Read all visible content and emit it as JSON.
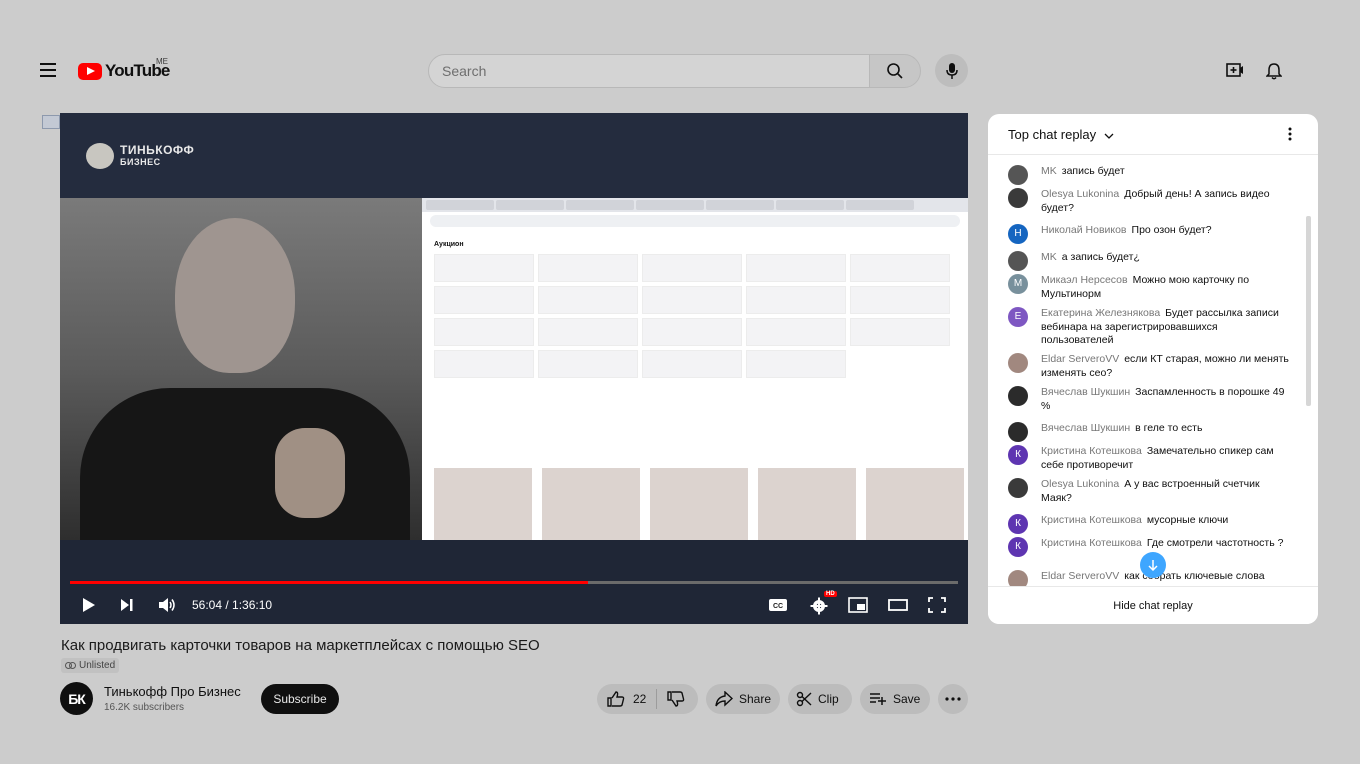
{
  "header": {
    "logo_text": "YouTube",
    "country": "ME",
    "search_placeholder": "Search"
  },
  "video": {
    "brand_line1": "ТИНЬКОФФ",
    "brand_line2": "БИЗНЕС",
    "screen_heading": "Аукцион",
    "time_current": "56:04",
    "time_total": "1:36:10",
    "time_display": "56:04 / 1:36:10",
    "progress_fraction": 0.583,
    "hd_label": "HD"
  },
  "meta": {
    "title": "Как продвигать карточки товаров на маркетплейсах с помощью SEO",
    "visibility": "Unlisted",
    "channel_initials": "БК",
    "channel_name": "Тинькофф Про Бизнес",
    "subscribers": "16.2K subscribers",
    "subscribe_label": "Subscribe",
    "like_count": "22",
    "share_label": "Share",
    "clip_label": "Clip",
    "save_label": "Save"
  },
  "chat": {
    "title": "Top chat replay",
    "footer": "Hide chat replay",
    "messages": [
      {
        "author": "MK",
        "text": "запись будет",
        "initial": "",
        "color": "#555555"
      },
      {
        "author": "Olesya Lukonina",
        "text": "Добрый день! А запись видео будет?",
        "initial": "",
        "color": "#3a3a3a"
      },
      {
        "author": "Николай Новиков",
        "text": "Про озон будет?",
        "initial": "Н",
        "color": "#1565c0"
      },
      {
        "author": "MK",
        "text": "а запись будет¿",
        "initial": "",
        "color": "#555555"
      },
      {
        "author": "Микаэл Нерсесов",
        "text": "Можно мою карточку по Мультинорм",
        "initial": "М",
        "color": "#78909c"
      },
      {
        "author": "Екатерина Железнякова",
        "text": "Будет рассылка записи вебинара на зарегистрировавшихся пользователей",
        "initial": "Е",
        "color": "#7e57c2"
      },
      {
        "author": "Eldar ServeroVV",
        "text": "если КТ старая, можно ли менять изменять сео?",
        "initial": "",
        "color": "#a1887f"
      },
      {
        "author": "Вячеслав Шукшин",
        "text": "Заспамленность в порошке 49 %",
        "initial": "",
        "color": "#2b2b2b"
      },
      {
        "author": "Вячеслав Шукшин",
        "text": "в геле то есть",
        "initial": "",
        "color": "#2b2b2b"
      },
      {
        "author": "Кристина Котешкова",
        "text": "Замечательно спикер сам себе противоречит",
        "initial": "К",
        "color": "#5e35b1"
      },
      {
        "author": "Olesya Lukonina",
        "text": "А у вас встроенный счетчик Маяк?",
        "initial": "",
        "color": "#3a3a3a"
      },
      {
        "author": "Кристина Котешкова",
        "text": "мусорные ключи",
        "initial": "К",
        "color": "#5e35b1"
      },
      {
        "author": "Кристина Котешкова",
        "text": "Где смотрели частотность ?",
        "initial": "К",
        "color": "#5e35b1"
      },
      {
        "author": "Eldar ServeroVV",
        "text": "как собрать ключевые слова",
        "initial": "",
        "color": "#a1887f"
      }
    ]
  },
  "icons": {
    "menu": "hamburger-icon",
    "search": "search-icon",
    "mic": "microphone-icon",
    "create": "create-icon",
    "notifications": "bell-icon"
  }
}
